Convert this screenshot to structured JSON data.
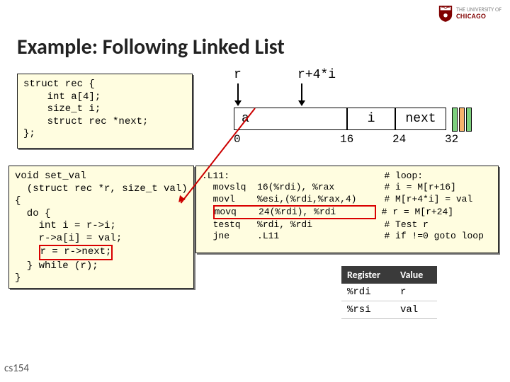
{
  "logo": {
    "line1": "THE UNIVERSITY OF",
    "line2": "CHICAGO"
  },
  "title": "Example: Following Linked List",
  "code_struct": "struct rec {\n    int a[4];\n    size_t i;\n    struct rec *next;\n};",
  "code_func_pre": "void set_val\n  (struct rec *r, size_t val)\n{\n  do {\n    int i = r->i;\n    r->a[i] = val;\n    ",
  "code_func_hl": "r = r->next;",
  "code_func_post": "\n  } while (r);\n}",
  "asm": {
    "l0": ".L11:                            # loop:",
    "l1": "  movslq  16(%rdi), %rax         # i = M[r+16]",
    "l2": "  movl    %esi,(%rdi,%rax,4)     # M[r+4*i] = val",
    "l3a": "  ",
    "l3hl": "movq    24(%rdi), %rdi       ",
    "l3b": "# r = M[r+24]",
    "l4": "  testq   %rdi, %rdi             # Test r",
    "l5": "  jne     .L11                   # if !=0 goto loop"
  },
  "diagram": {
    "r": "r",
    "r4i": "r+4*i",
    "a": "a",
    "i": "i",
    "next": "next",
    "off0": "0",
    "off16": "16",
    "off24": "24",
    "off32": "32"
  },
  "reg": {
    "h1": "Register",
    "h2": "Value",
    "r1c1": "%rdi",
    "r1c2": "r",
    "r2c1": "%rsi",
    "r2c2": "val"
  },
  "footer": "cs154"
}
